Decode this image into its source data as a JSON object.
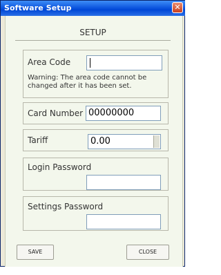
{
  "window": {
    "title": "Software Setup",
    "close_glyph": "✕"
  },
  "setup": {
    "heading": "SETUP"
  },
  "area_code": {
    "label": "Area Code",
    "value": "",
    "warning": "Warning: The area code cannot be changed after it has been set."
  },
  "card_number": {
    "label": "Card Number",
    "value": "00000000"
  },
  "tariff": {
    "label": "Tariff",
    "value": "0.00"
  },
  "login_password": {
    "label": "Login Password",
    "value": ""
  },
  "settings_password": {
    "label": "Settings Password",
    "value": ""
  },
  "buttons": {
    "save": "SAVE",
    "close": "CLOSE"
  }
}
